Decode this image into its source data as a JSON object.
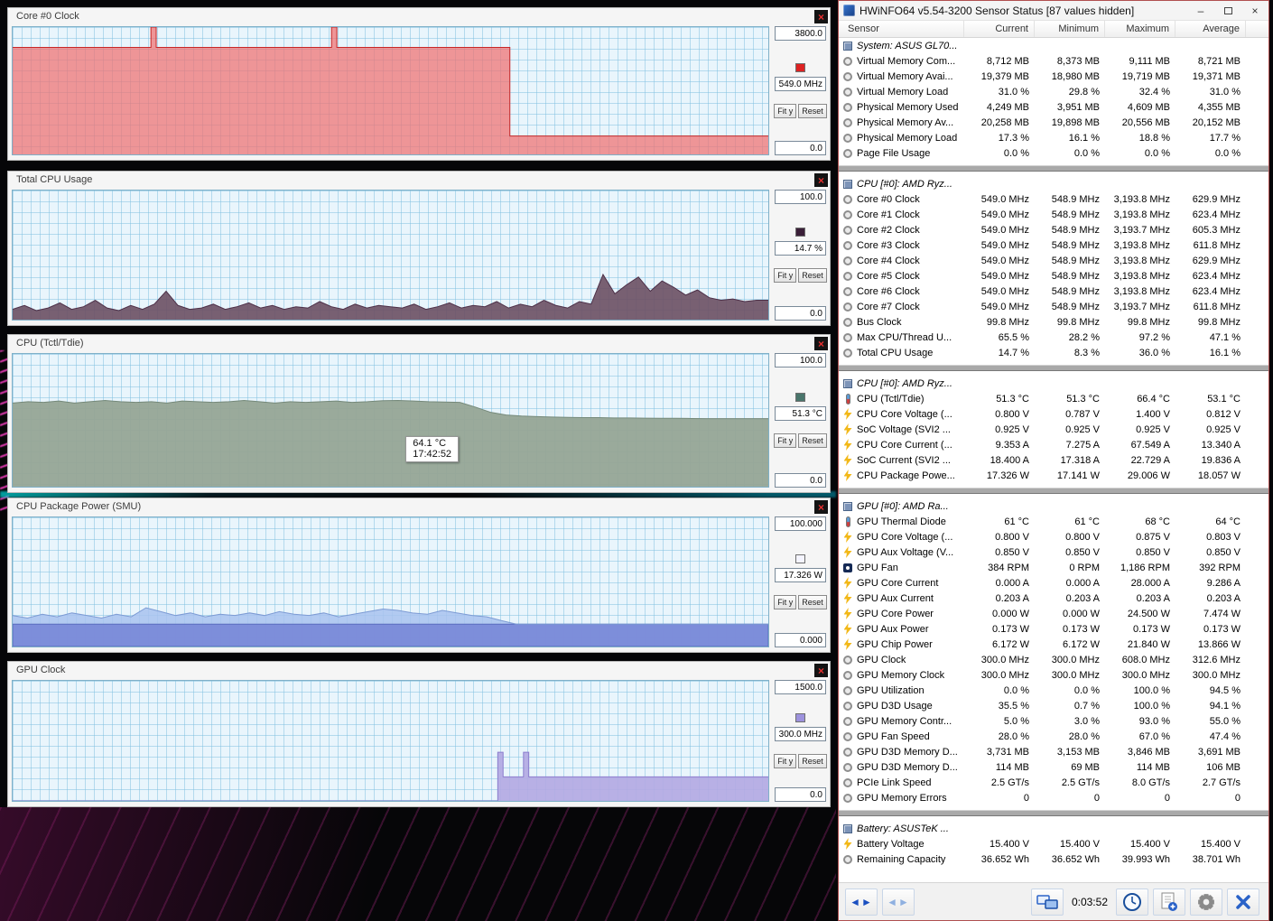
{
  "graphs": [
    {
      "title": "Core #0 Clock",
      "max_label": "3800.0",
      "min_label": "0.0",
      "current_label": "549.0 MHz",
      "fit_label": "Fit y",
      "reset_label": "Reset",
      "legend_color": "#dd2222",
      "fill_color": "rgba(240,112,112,0.72)",
      "stroke_color": "#c62828",
      "y_max": 3800,
      "points": [
        [
          0,
          3194
        ],
        [
          18.3,
          3194
        ],
        [
          18.3,
          3800
        ],
        [
          19.0,
          3800
        ],
        [
          19.0,
          3194
        ],
        [
          42.2,
          3194
        ],
        [
          42.2,
          3800
        ],
        [
          42.9,
          3800
        ],
        [
          42.9,
          3194
        ],
        [
          65.8,
          3194
        ],
        [
          65.8,
          549
        ],
        [
          100,
          549
        ]
      ]
    },
    {
      "title": "Total CPU Usage",
      "max_label": "100.0",
      "min_label": "0.0",
      "current_label": "14.7 %",
      "fit_label": "Fit y",
      "reset_label": "Reset",
      "legend_color": "#3a1f38",
      "fill_color": "rgba(110,82,102,0.92)",
      "stroke_color": "#4d3048",
      "y_max": 100,
      "values": [
        8,
        11,
        7,
        9,
        13,
        8,
        10,
        15,
        9,
        7,
        11,
        8,
        12,
        22,
        11,
        8,
        9,
        12,
        8,
        10,
        13,
        9,
        11,
        8,
        10,
        9,
        14,
        10,
        8,
        12,
        9,
        11,
        10,
        9,
        12,
        8,
        10,
        13,
        9,
        11,
        10,
        14,
        9,
        12,
        10,
        15,
        11,
        9,
        14,
        12,
        35,
        20,
        27,
        33,
        22,
        30,
        25,
        19,
        23,
        17,
        15,
        16,
        14,
        15,
        15
      ]
    },
    {
      "title": "CPU (Tctl/Tdie)",
      "max_label": "100.0",
      "min_label": "0.0",
      "current_label": "51.3 °C",
      "fit_label": "Fit y",
      "reset_label": "Reset",
      "legend_color": "#49756b",
      "fill_color": "rgba(150,165,150,0.95)",
      "stroke_color": "#75897a",
      "y_max": 100,
      "values": [
        63,
        64,
        63.5,
        64.5,
        63,
        64,
        65,
        64,
        63.5,
        64,
        63,
        64.5,
        64,
        63.5,
        64,
        65,
        64,
        63,
        64,
        63.5,
        64,
        64.5,
        63.5,
        64,
        64.8,
        65,
        64.5,
        64,
        63.8,
        63.5,
        60,
        56,
        54,
        53.2,
        52.8,
        52.5,
        52.2,
        52,
        52,
        51.8,
        51.8,
        51.6,
        51.5,
        51.5,
        51.4,
        51.3,
        51.3,
        51.3,
        51.3,
        51.3
      ]
    },
    {
      "title": "CPU Package Power (SMU)",
      "max_label": "100.000",
      "min_label": "0.000",
      "current_label": "17.326 W",
      "fit_label": "Fit y",
      "reset_label": "Reset",
      "legend_color": "#f4f4ff",
      "fill_color": "rgba(168,194,238,0.85)",
      "stroke_color": "#7d9bd4",
      "band_value": 17.3,
      "band_color": "rgba(122,138,216,0.95)",
      "band_stroke": "#5a6cc0",
      "y_max": 100,
      "values": [
        24,
        22,
        25,
        23,
        26,
        24,
        22,
        25,
        23,
        30,
        27,
        24,
        26,
        23,
        25,
        24,
        26,
        24,
        27,
        25,
        24,
        26,
        23,
        25,
        27,
        29,
        28,
        26,
        25,
        28,
        26,
        24,
        23,
        20,
        17.3,
        17.3,
        17.3,
        17.3,
        17.3,
        17.3,
        17.3,
        17.3,
        17.3,
        17.3,
        17.3,
        17.3,
        17.3,
        17.3,
        17.3,
        17.3,
        17.3,
        17.3
      ]
    },
    {
      "title": "GPU Clock",
      "max_label": "1500.0",
      "min_label": "0.0",
      "current_label": "300.0 MHz",
      "fit_label": "Fit y",
      "reset_label": "Reset",
      "legend_color": "#9d92dd",
      "fill_color": "rgba(178,168,226,0.9)",
      "stroke_color": "#8a7ccd",
      "y_max": 1500,
      "points": [
        [
          0,
          0
        ],
        [
          64.2,
          0
        ],
        [
          64.2,
          608
        ],
        [
          64.9,
          608
        ],
        [
          64.9,
          300
        ],
        [
          67.6,
          300
        ],
        [
          67.6,
          608
        ],
        [
          68.3,
          608
        ],
        [
          68.3,
          300
        ],
        [
          100,
          300
        ]
      ]
    }
  ],
  "tooltip": {
    "value": "64.1 °C",
    "time": "17:42:52"
  },
  "sensor_window": {
    "title": "HWiNFO64 v5.54-3200 Sensor Status [87 values hidden]",
    "controls": {
      "minimize": "–",
      "close": "×"
    },
    "columns": [
      "Sensor",
      "Current",
      "Minimum",
      "Maximum",
      "Average"
    ],
    "groups": [
      {
        "label": "System: ASUS GL70...",
        "rows": [
          {
            "icon": "gauge",
            "name": "Virtual Memory Com...",
            "values": [
              "8,712 MB",
              "8,373 MB",
              "9,111 MB",
              "8,721 MB"
            ]
          },
          {
            "icon": "gauge",
            "name": "Virtual Memory Avai...",
            "values": [
              "19,379 MB",
              "18,980 MB",
              "19,719 MB",
              "19,371 MB"
            ]
          },
          {
            "icon": "gauge",
            "name": "Virtual Memory Load",
            "values": [
              "31.0 %",
              "29.8 %",
              "32.4 %",
              "31.0 %"
            ]
          },
          {
            "icon": "gauge",
            "name": "Physical Memory Used",
            "values": [
              "4,249 MB",
              "3,951 MB",
              "4,609 MB",
              "4,355 MB"
            ]
          },
          {
            "icon": "gauge",
            "name": "Physical Memory Av...",
            "values": [
              "20,258 MB",
              "19,898 MB",
              "20,556 MB",
              "20,152 MB"
            ]
          },
          {
            "icon": "gauge",
            "name": "Physical Memory Load",
            "values": [
              "17.3 %",
              "16.1 %",
              "18.8 %",
              "17.7 %"
            ]
          },
          {
            "icon": "gauge",
            "name": "Page File Usage",
            "values": [
              "0.0 %",
              "0.0 %",
              "0.0 %",
              "0.0 %"
            ]
          }
        ]
      },
      {
        "label": "CPU [#0]: AMD Ryz...",
        "rows": [
          {
            "icon": "gauge",
            "name": "Core #0 Clock",
            "values": [
              "549.0 MHz",
              "548.9 MHz",
              "3,193.8 MHz",
              "629.9 MHz"
            ]
          },
          {
            "icon": "gauge",
            "name": "Core #1 Clock",
            "values": [
              "549.0 MHz",
              "548.9 MHz",
              "3,193.8 MHz",
              "623.4 MHz"
            ]
          },
          {
            "icon": "gauge",
            "name": "Core #2 Clock",
            "values": [
              "549.0 MHz",
              "548.9 MHz",
              "3,193.7 MHz",
              "605.3 MHz"
            ]
          },
          {
            "icon": "gauge",
            "name": "Core #3 Clock",
            "values": [
              "549.0 MHz",
              "548.9 MHz",
              "3,193.8 MHz",
              "611.8 MHz"
            ]
          },
          {
            "icon": "gauge",
            "name": "Core #4 Clock",
            "values": [
              "549.0 MHz",
              "548.9 MHz",
              "3,193.8 MHz",
              "629.9 MHz"
            ]
          },
          {
            "icon": "gauge",
            "name": "Core #5 Clock",
            "values": [
              "549.0 MHz",
              "548.9 MHz",
              "3,193.8 MHz",
              "623.4 MHz"
            ]
          },
          {
            "icon": "gauge",
            "name": "Core #6 Clock",
            "values": [
              "549.0 MHz",
              "548.9 MHz",
              "3,193.8 MHz",
              "623.4 MHz"
            ]
          },
          {
            "icon": "gauge",
            "name": "Core #7 Clock",
            "values": [
              "549.0 MHz",
              "548.9 MHz",
              "3,193.7 MHz",
              "611.8 MHz"
            ]
          },
          {
            "icon": "gauge",
            "name": "Bus Clock",
            "values": [
              "99.8 MHz",
              "99.8 MHz",
              "99.8 MHz",
              "99.8 MHz"
            ]
          },
          {
            "icon": "gauge",
            "name": "Max CPU/Thread U...",
            "values": [
              "65.5 %",
              "28.2 %",
              "97.2 %",
              "47.1 %"
            ]
          },
          {
            "icon": "gauge",
            "name": "Total CPU Usage",
            "values": [
              "14.7 %",
              "8.3 %",
              "36.0 %",
              "16.1 %"
            ]
          }
        ]
      },
      {
        "label": "CPU [#0]: AMD Ryz...",
        "rows": [
          {
            "icon": "temp",
            "name": "CPU (Tctl/Tdie)",
            "values": [
              "51.3 °C",
              "51.3 °C",
              "66.4 °C",
              "53.1 °C"
            ]
          },
          {
            "icon": "power",
            "name": "CPU Core Voltage (...",
            "values": [
              "0.800 V",
              "0.787 V",
              "1.400 V",
              "0.812 V"
            ]
          },
          {
            "icon": "power",
            "name": "SoC Voltage (SVI2 ...",
            "values": [
              "0.925 V",
              "0.925 V",
              "0.925 V",
              "0.925 V"
            ]
          },
          {
            "icon": "power",
            "name": "CPU Core Current (...",
            "values": [
              "9.353 A",
              "7.275 A",
              "67.549 A",
              "13.340 A"
            ]
          },
          {
            "icon": "power",
            "name": "SoC Current (SVI2 ...",
            "values": [
              "18.400 A",
              "17.318 A",
              "22.729 A",
              "19.836 A"
            ]
          },
          {
            "icon": "power",
            "name": "CPU Package Powe...",
            "values": [
              "17.326 W",
              "17.141 W",
              "29.006 W",
              "18.057 W"
            ]
          }
        ]
      },
      {
        "label": "GPU [#0]: AMD Ra...",
        "rows": [
          {
            "icon": "temp",
            "name": "GPU Thermal Diode",
            "values": [
              "61 °C",
              "61 °C",
              "68 °C",
              "64 °C"
            ]
          },
          {
            "icon": "power",
            "name": "GPU Core Voltage (...",
            "values": [
              "0.800 V",
              "0.800 V",
              "0.875 V",
              "0.803 V"
            ]
          },
          {
            "icon": "power",
            "name": "GPU Aux Voltage (V...",
            "values": [
              "0.850 V",
              "0.850 V",
              "0.850 V",
              "0.850 V"
            ]
          },
          {
            "icon": "fan",
            "name": "GPU Fan",
            "values": [
              "384 RPM",
              "0 RPM",
              "1,186 RPM",
              "392 RPM"
            ]
          },
          {
            "icon": "power",
            "name": "GPU Core Current",
            "values": [
              "0.000 A",
              "0.000 A",
              "28.000 A",
              "9.286 A"
            ]
          },
          {
            "icon": "power",
            "name": "GPU Aux Current",
            "values": [
              "0.203 A",
              "0.203 A",
              "0.203 A",
              "0.203 A"
            ]
          },
          {
            "icon": "power",
            "name": "GPU Core Power",
            "values": [
              "0.000 W",
              "0.000 W",
              "24.500 W",
              "7.474 W"
            ]
          },
          {
            "icon": "power",
            "name": "GPU Aux Power",
            "values": [
              "0.173 W",
              "0.173 W",
              "0.173 W",
              "0.173 W"
            ]
          },
          {
            "icon": "power",
            "name": "GPU Chip Power",
            "values": [
              "6.172 W",
              "6.172 W",
              "21.840 W",
              "13.866 W"
            ]
          },
          {
            "icon": "gauge",
            "name": "GPU Clock",
            "values": [
              "300.0 MHz",
              "300.0 MHz",
              "608.0 MHz",
              "312.6 MHz"
            ]
          },
          {
            "icon": "gauge",
            "name": "GPU Memory Clock",
            "values": [
              "300.0 MHz",
              "300.0 MHz",
              "300.0 MHz",
              "300.0 MHz"
            ]
          },
          {
            "icon": "gauge",
            "name": "GPU Utilization",
            "values": [
              "0.0 %",
              "0.0 %",
              "100.0 %",
              "94.5 %"
            ]
          },
          {
            "icon": "gauge",
            "name": "GPU D3D Usage",
            "values": [
              "35.5 %",
              "0.7 %",
              "100.0 %",
              "94.1 %"
            ]
          },
          {
            "icon": "gauge",
            "name": "GPU Memory Contr...",
            "values": [
              "5.0 %",
              "3.0 %",
              "93.0 %",
              "55.0 %"
            ]
          },
          {
            "icon": "gauge",
            "name": "GPU Fan Speed",
            "values": [
              "28.0 %",
              "28.0 %",
              "67.0 %",
              "47.4 %"
            ]
          },
          {
            "icon": "gauge",
            "name": "GPU D3D Memory D...",
            "values": [
              "3,731 MB",
              "3,153 MB",
              "3,846 MB",
              "3,691 MB"
            ]
          },
          {
            "icon": "gauge",
            "name": "GPU D3D Memory D...",
            "values": [
              "114 MB",
              "69 MB",
              "114 MB",
              "106 MB"
            ]
          },
          {
            "icon": "gauge",
            "name": "PCIe Link Speed",
            "values": [
              "2.5 GT/s",
              "2.5 GT/s",
              "8.0 GT/s",
              "2.7 GT/s"
            ]
          },
          {
            "icon": "gauge",
            "name": "GPU Memory Errors",
            "values": [
              "0",
              "0",
              "0",
              "0"
            ]
          }
        ]
      },
      {
        "label": "Battery: ASUSTeK ...",
        "rows": [
          {
            "icon": "power",
            "name": "Battery Voltage",
            "values": [
              "15.400 V",
              "15.400 V",
              "15.400 V",
              "15.400 V"
            ]
          },
          {
            "icon": "gauge",
            "name": "Remaining Capacity",
            "values": [
              "36.652 Wh",
              "36.652 Wh",
              "39.993 Wh",
              "38.701 Wh"
            ]
          }
        ]
      }
    ],
    "toolbar": {
      "time": "0:03:52"
    }
  }
}
